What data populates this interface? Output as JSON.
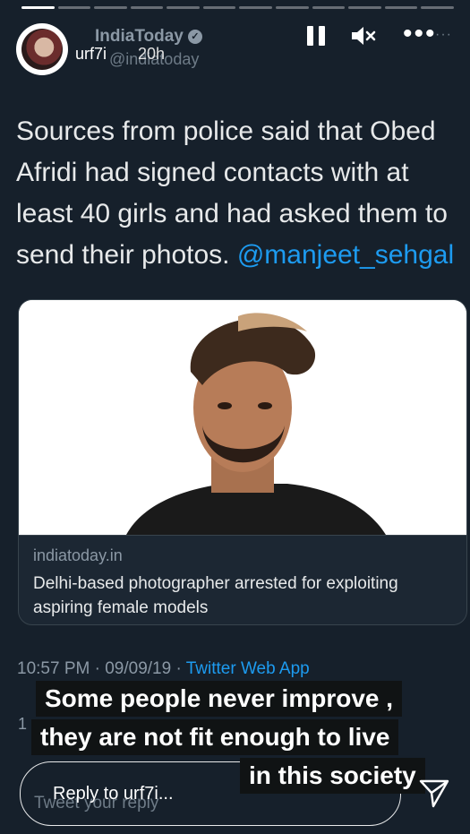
{
  "story": {
    "username": "urf7i",
    "time_ago": "20h",
    "reply_placeholder": "Reply to urf7i..."
  },
  "tweet": {
    "author_name": "IndiaToday",
    "handle": "@indiatoday",
    "text": "Sources from police said that Obed Afridi had signed contacts with at least 40 girls and had asked them to send their photos.",
    "mention": "@manjeet_sehgal",
    "card_domain": "indiatoday.in",
    "card_title": "Delhi-based photographer arrested for exploiting aspiring female models",
    "timestamp": "10:57 PM · 09/09/19 · ",
    "app": "Twitter Web App",
    "count_partial": "1",
    "reply_placeholder_ghost": "Tweet your reply"
  },
  "caption": {
    "line1": "Some people never improve ,",
    "line2": "they are not fit enough to live",
    "line3": "in this society"
  },
  "icons": [
    "pause-icon",
    "mute-icon",
    "more-icon",
    "verified-icon",
    "send-icon"
  ],
  "colors": {
    "background": "#16202b",
    "link": "#1d9bf0",
    "muted": "#8b98a5",
    "caption_bg": "#101314"
  }
}
